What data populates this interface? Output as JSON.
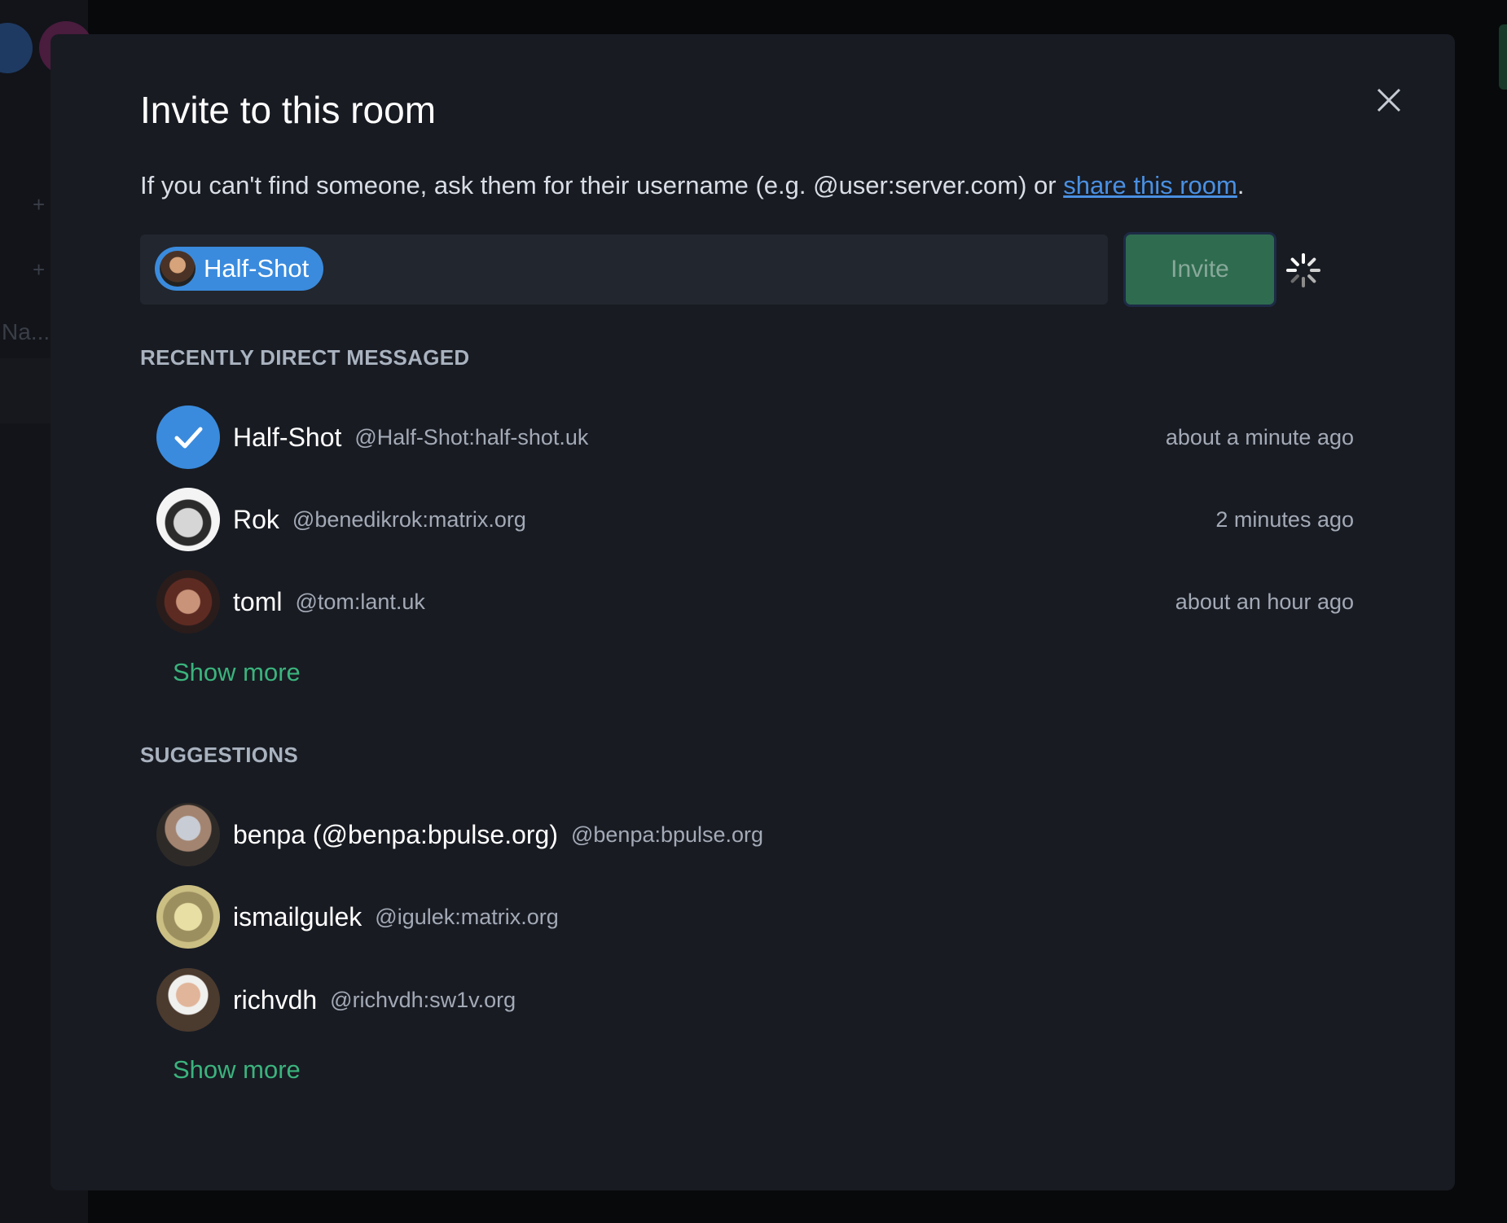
{
  "background": {
    "sidebar_partial_text": "Na..."
  },
  "dialog": {
    "title": "Invite to this room",
    "subtitle_text": "If you can't find someone, ask them for their username (e.g. @user:server.com) or ",
    "subtitle_link": "share this room",
    "subtitle_end": ".",
    "selected_pill": "Half-Shot",
    "invite_label": "Invite",
    "close_icon": "close-icon",
    "loading_icon": "spinner-icon"
  },
  "recent": {
    "heading": "RECENTLY DIRECT MESSAGED",
    "items": [
      {
        "name": "Half-Shot",
        "id": "@Half-Shot:half-shot.uk",
        "time": "about a minute ago",
        "selected": true
      },
      {
        "name": "Rok",
        "id": "@benedikrok:matrix.org",
        "time": "2 minutes ago",
        "selected": false
      },
      {
        "name": "toml",
        "id": "@tom:lant.uk",
        "time": "about an hour ago",
        "selected": false
      }
    ],
    "show_more": "Show more"
  },
  "suggestions": {
    "heading": "SUGGESTIONS",
    "items": [
      {
        "name": "benpa (@benpa:bpulse.org)",
        "id": "@benpa:bpulse.org"
      },
      {
        "name": "ismailgulek",
        "id": "@igulek:matrix.org"
      },
      {
        "name": "richvdh",
        "id": "@richvdh:sw1v.org"
      }
    ],
    "show_more": "Show more"
  },
  "colors": {
    "accent_green": "#3bb37d",
    "link_blue": "#4a90e2",
    "pill_blue": "#3a8bdd",
    "dialog_bg": "#181b22"
  }
}
